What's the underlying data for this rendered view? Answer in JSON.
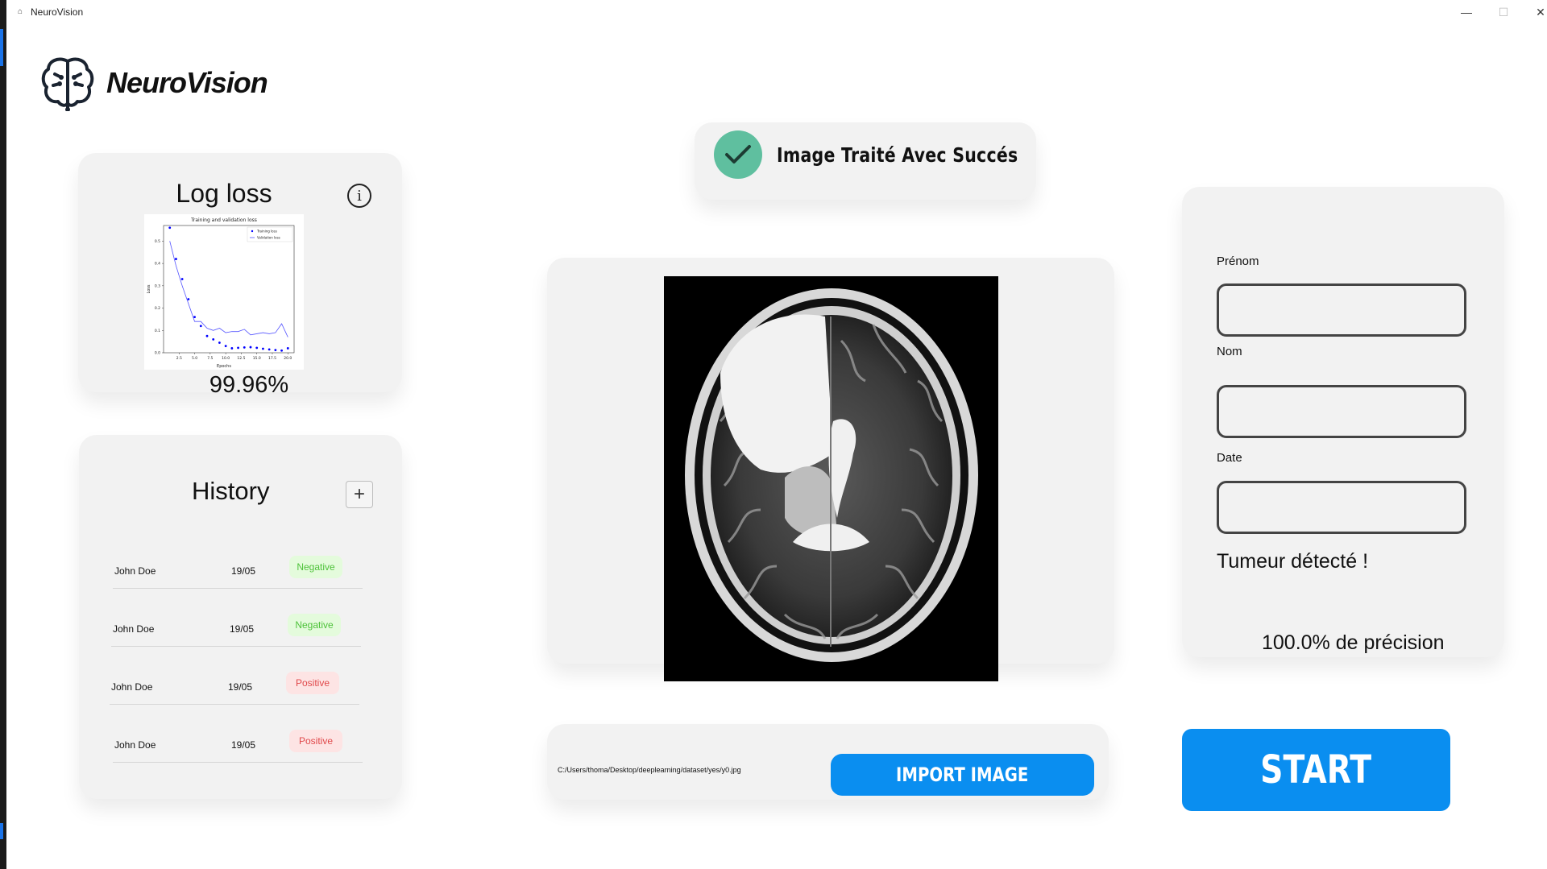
{
  "window": {
    "title": "NeuroVision",
    "minimize": "—",
    "maximize": "☐",
    "close": "✕"
  },
  "brand": {
    "name": "NeuroVision",
    "icon": "brain-icon"
  },
  "logloss": {
    "title": "Log loss",
    "info_icon": "info-icon",
    "accuracy": "99.96%",
    "chart_data": {
      "type": "line",
      "title": "Training and validation loss",
      "xlabel": "Epochs",
      "ylabel": "Loss",
      "xlim": [
        0,
        21
      ],
      "ylim": [
        0,
        0.57
      ],
      "xticks": [
        "2.5",
        "5.0",
        "7.5",
        "10.0",
        "12.5",
        "15.0",
        "17.5",
        "20.0"
      ],
      "yticks": [
        "0.0",
        "0.1",
        "0.2",
        "0.3",
        "0.4",
        "0.5"
      ],
      "legend": [
        "Training loss",
        "Validation loss"
      ],
      "legend_position": "top-right",
      "series": [
        {
          "name": "Training loss",
          "style": "dots",
          "color": "#0000ff",
          "x": [
            1,
            2,
            3,
            4,
            5,
            6,
            7,
            8,
            9,
            10,
            11,
            12,
            13,
            14,
            15,
            16,
            17,
            18,
            19,
            20
          ],
          "values": [
            0.56,
            0.42,
            0.33,
            0.24,
            0.16,
            0.12,
            0.075,
            0.06,
            0.045,
            0.03,
            0.02,
            0.022,
            0.024,
            0.025,
            0.022,
            0.018,
            0.015,
            0.012,
            0.01,
            0.02
          ]
        },
        {
          "name": "Validation loss",
          "style": "line",
          "color": "#5555ff",
          "x": [
            1,
            2,
            3,
            4,
            5,
            6,
            7,
            8,
            9,
            10,
            11,
            12,
            13,
            14,
            15,
            16,
            17,
            18,
            19,
            20
          ],
          "values": [
            0.5,
            0.39,
            0.3,
            0.22,
            0.14,
            0.14,
            0.11,
            0.1,
            0.11,
            0.09,
            0.095,
            0.095,
            0.105,
            0.08,
            0.085,
            0.09,
            0.085,
            0.09,
            0.13,
            0.07
          ]
        }
      ]
    }
  },
  "history": {
    "title": "History",
    "add_icon": "plus-icon",
    "rows": [
      {
        "name": "John Doe",
        "date": "19/05",
        "result": "Negative",
        "status": "negative"
      },
      {
        "name": "John Doe",
        "date": "19/05",
        "result": "Negative",
        "status": "negative"
      },
      {
        "name": "John Doe",
        "date": "19/05",
        "result": "Positive",
        "status": "positive"
      },
      {
        "name": "John Doe",
        "date": "19/05",
        "result": "Positive",
        "status": "positive"
      }
    ]
  },
  "status": {
    "message": "Image Traité Avec Succés",
    "icon": "checkmark-icon",
    "color": "#5fbf9f"
  },
  "form": {
    "first_name_label": "Prénom",
    "first_name_value": "",
    "last_name_label": "Nom",
    "last_name_value": "",
    "date_label": "Date",
    "date_value": "",
    "result": "Tumeur détecté !",
    "precision": "100.0% de précision"
  },
  "file": {
    "path": "C:/Users/thoma/Desktop/deeplearning/dataset/yes/y0.jpg"
  },
  "buttons": {
    "import": "IMPORT IMAGE",
    "start": "START"
  },
  "colors": {
    "accent": "#0a8ef0",
    "negative_bg": "#e4fbdc",
    "negative_text": "#4ec23a",
    "positive_bg": "#fde4e4",
    "positive_text": "#e0484a",
    "card_bg": "#f2f2f2"
  }
}
